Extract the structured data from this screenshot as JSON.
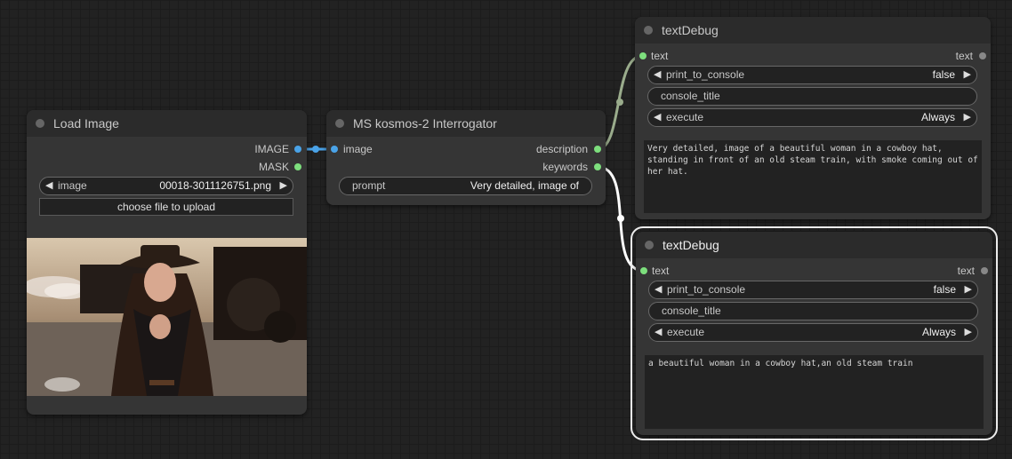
{
  "colors": {
    "image_link": "#4aa3e8",
    "string_slot": "#7ddf7d",
    "link_gray": "#9aac8c",
    "link_white": "#ffffff"
  },
  "load_image": {
    "title": "Load Image",
    "out_image": "IMAGE",
    "out_mask": "MASK",
    "widget_label": "image",
    "widget_value": "00018-3011126751.png",
    "upload_label": "choose file to upload"
  },
  "kosmos": {
    "title": "MS kosmos-2 Interrogator",
    "in_image": "image",
    "out_description": "description",
    "out_keywords": "keywords",
    "prompt_label": "prompt",
    "prompt_value": "Very detailed, image of"
  },
  "debug1": {
    "title": "textDebug",
    "in_text": "text",
    "out_text": "text",
    "print_label": "print_to_console",
    "print_value": "false",
    "console_title_label": "console_title",
    "execute_label": "execute",
    "execute_value": "Always",
    "output_text": "Very detailed, image of a beautiful woman in a cowboy hat, standing in front of an old steam train, with smoke coming out of her hat."
  },
  "debug2": {
    "title": "textDebug",
    "in_text": "text",
    "out_text": "text",
    "print_label": "print_to_console",
    "print_value": "false",
    "console_title_label": "console_title",
    "execute_label": "execute",
    "execute_value": "Always",
    "output_text": "a beautiful woman in a cowboy hat,an old steam train"
  }
}
